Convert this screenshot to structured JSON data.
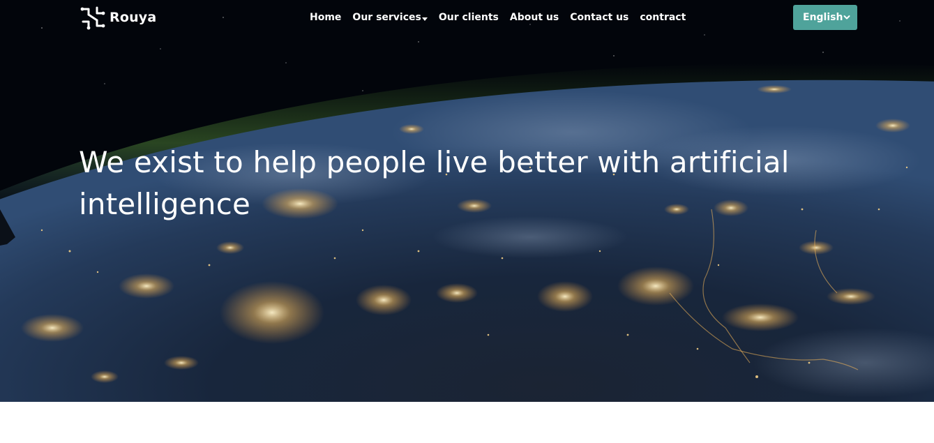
{
  "brand": {
    "name": "Rouya"
  },
  "nav": {
    "items": [
      {
        "label": "Home"
      },
      {
        "label": "Our services",
        "has_dropdown": true
      },
      {
        "label": "Our clients"
      },
      {
        "label": "About us"
      },
      {
        "label": "Contact us"
      },
      {
        "label": "contract"
      }
    ]
  },
  "language_select": {
    "value": "English",
    "icon": "chevron-down-icon"
  },
  "hero": {
    "headline": "We exist to help people live better with artificial intelligence",
    "background": "earth-at-night-from-space-image"
  },
  "colors": {
    "accent": "#4fa39b",
    "text_on_dark": "#ffffff",
    "page_background": "#ffffff"
  }
}
